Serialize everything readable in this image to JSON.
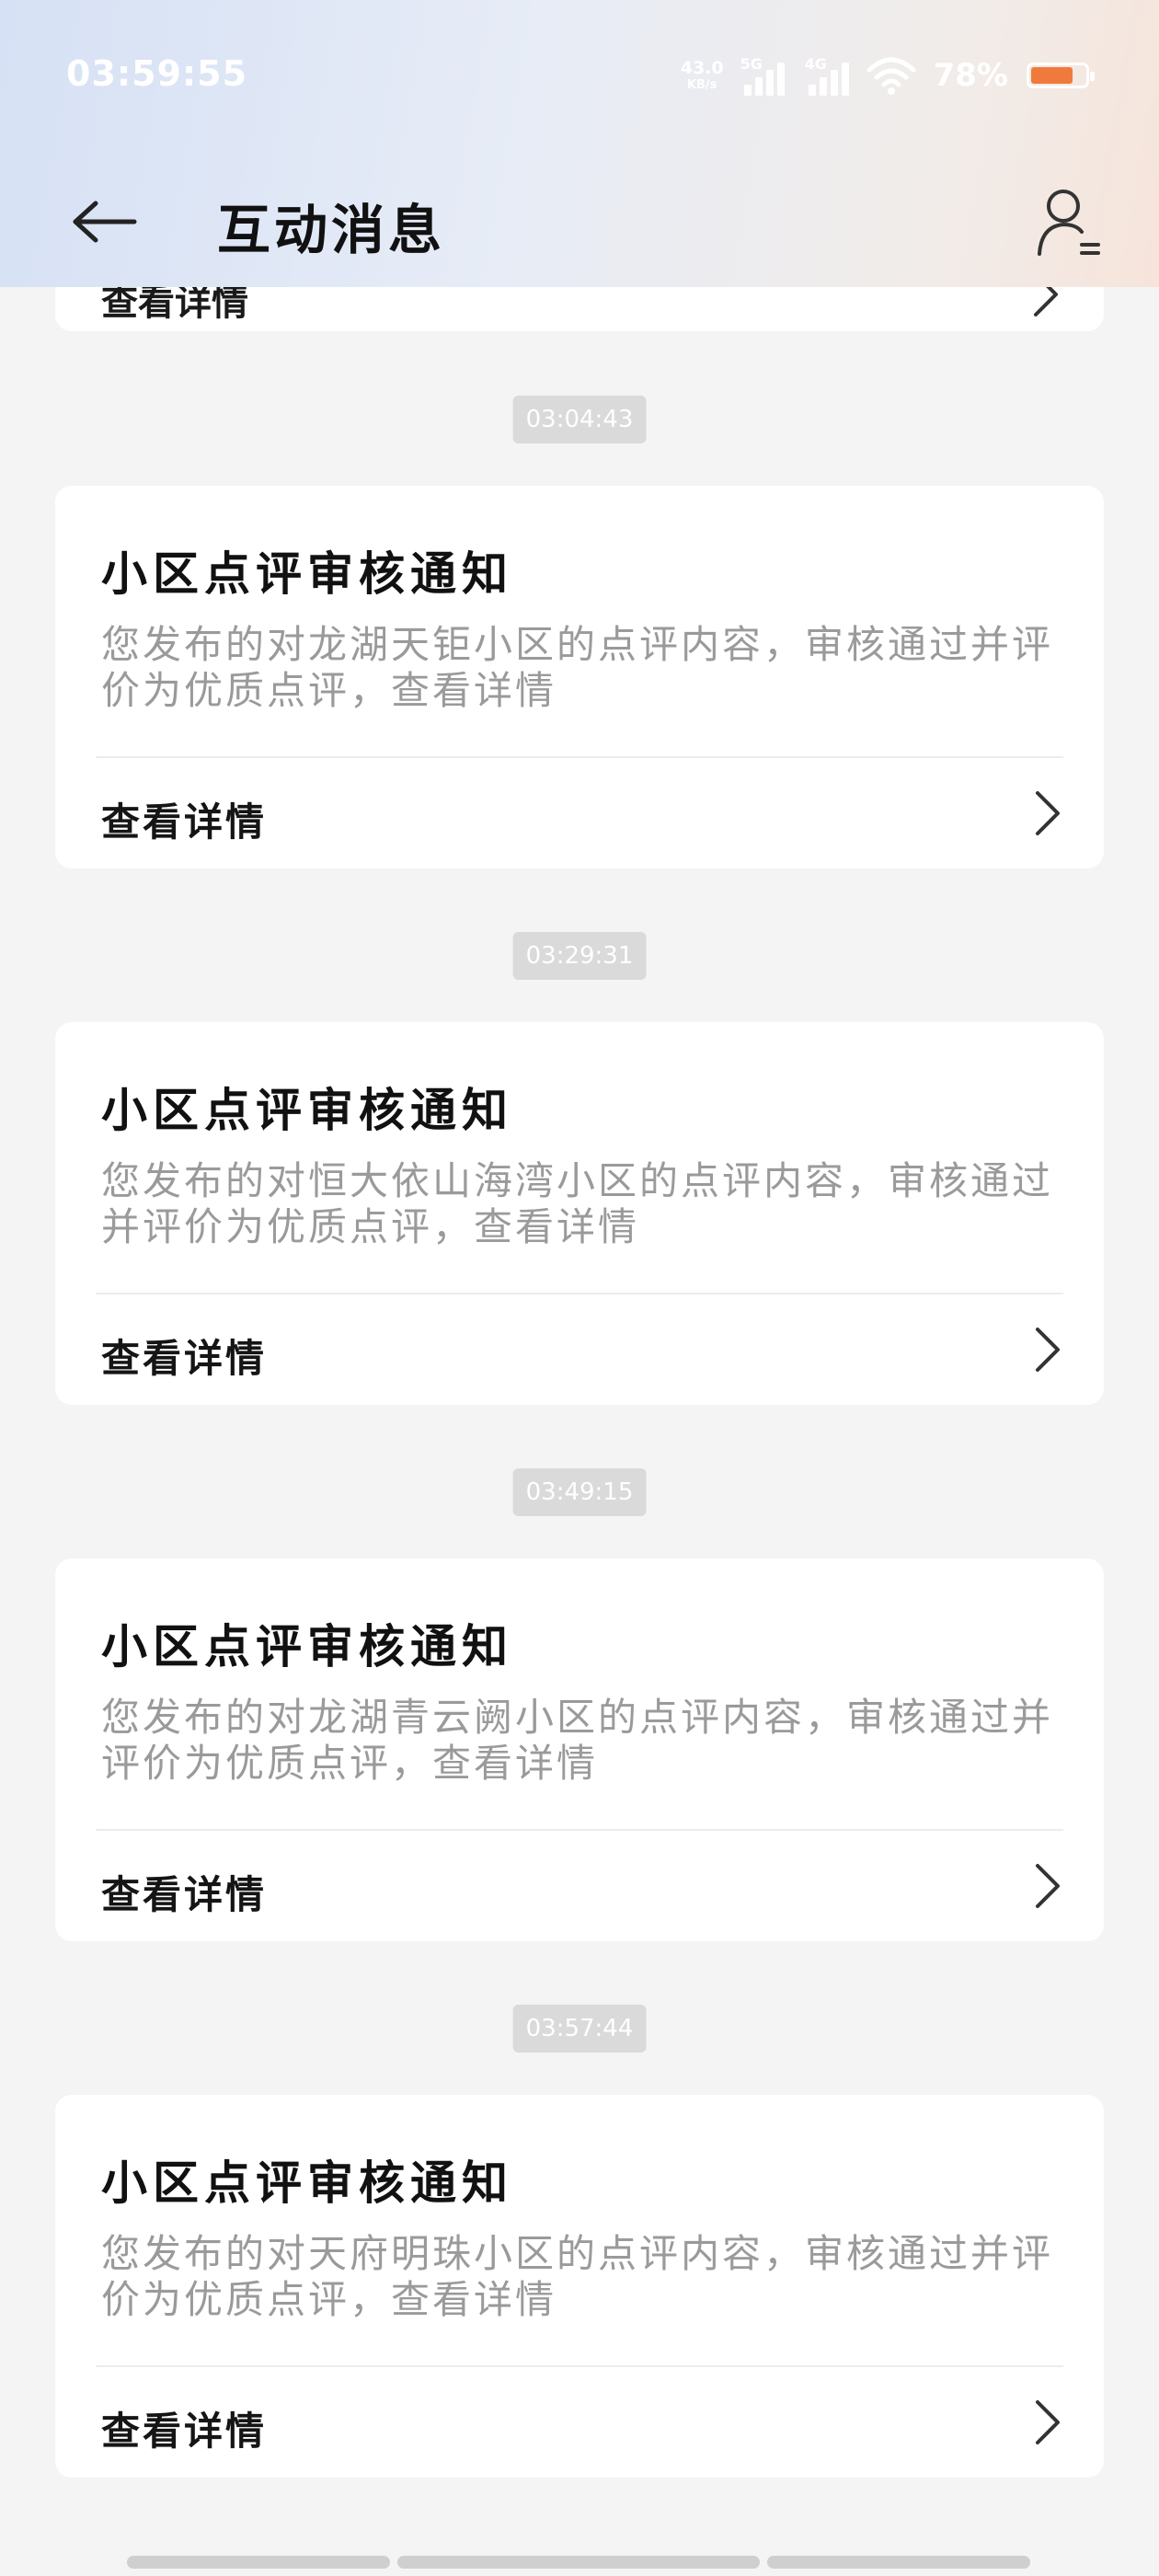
{
  "status_bar": {
    "time": "03:59:55",
    "net_speed_value": "43.0",
    "net_speed_unit": "KB/s",
    "signal_1_label": "5G",
    "signal_2_label": "4G",
    "battery_percent": "78%",
    "battery_level": 0.78,
    "icons": [
      "signal-5g-icon",
      "signal-4g-icon",
      "wifi-icon",
      "battery-icon"
    ]
  },
  "header": {
    "title": "互动消息",
    "back_icon": "arrow-left-icon",
    "user_icon": "user-list-icon"
  },
  "partial_card": {
    "link_label": "查看详情"
  },
  "messages": [
    {
      "timestamp": "03:04:43",
      "title": "小区点评审核通知",
      "body": "您发布的对龙湖天钜小区的点评内容，审核通过并评价为优质点评，查看详情",
      "link_label": "查看详情"
    },
    {
      "timestamp": "03:29:31",
      "title": "小区点评审核通知",
      "body": "您发布的对恒大依山海湾小区的点评内容，审核通过并评价为优质点评，查看详情",
      "link_label": "查看详情"
    },
    {
      "timestamp": "03:49:15",
      "title": "小区点评审核通知",
      "body": "您发布的对龙湖青云阙小区的点评内容，审核通过并评价为优质点评，查看详情",
      "link_label": "查看详情"
    },
    {
      "timestamp": "03:57:44",
      "title": "小区点评审核通知",
      "body": "您发布的对天府明珠小区的点评内容，审核通过并评价为优质点评，查看详情",
      "link_label": "查看详情"
    }
  ],
  "colors": {
    "page_background": "#f4f4f4",
    "card_background": "#ffffff",
    "body_text": "#9a9a9a",
    "timestamp_background": "#dadada",
    "battery_fill": "#f07a3c"
  }
}
